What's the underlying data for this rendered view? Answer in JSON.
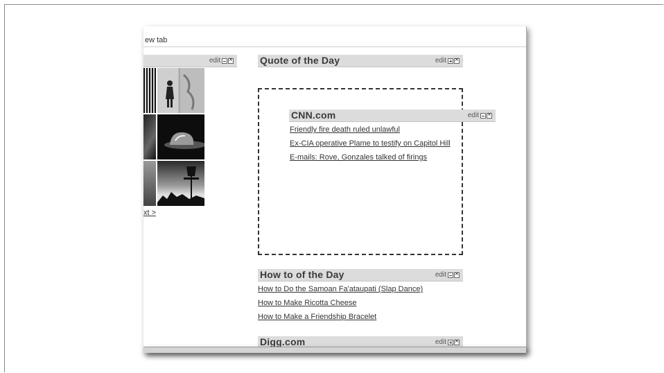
{
  "toolbar": {
    "tab_label": "ew tab"
  },
  "widgets": {
    "photo": {
      "edit": "edit",
      "next_link": "xt >"
    },
    "quote": {
      "title": "Quote of the Day",
      "edit": "edit"
    },
    "cnn": {
      "title": "CNN.com",
      "edit": "edit",
      "links": [
        "Friendly fire death ruled unlawful",
        "Ex-CIA operative Plame to testify on Capitol Hill",
        "E-mails: Rove, Gonzales talked of firings"
      ]
    },
    "howto": {
      "title": "How to of the Day",
      "edit": "edit",
      "links": [
        "How to Do the Samoan Fa'ataupati (Slap Dance)",
        "How to Make Ricotta Cheese",
        "How to Make a Friendship Bracelet"
      ]
    },
    "digg": {
      "title": "Digg.com",
      "edit": "edit"
    }
  },
  "icons": [
    "minimize-icon",
    "expand-icon",
    "close-icon"
  ],
  "colors": {
    "header_bg": "#dcdcdc",
    "link": "#333333"
  }
}
